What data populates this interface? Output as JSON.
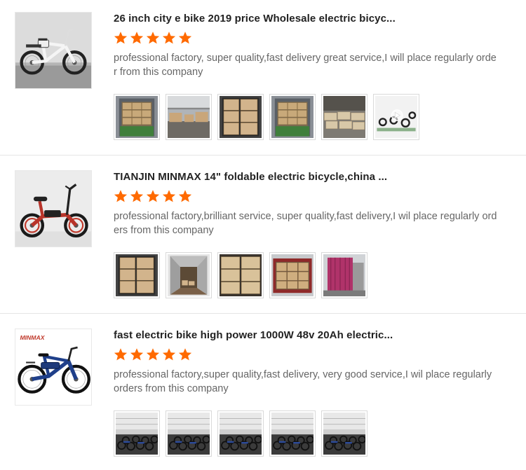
{
  "reviews": [
    {
      "title": "26 inch city e bike 2019 price Wholesale electric bicyc...",
      "rating": 5,
      "comment": "professional factory, super quality,fast delivery great service,I will place regularly order from this company",
      "product_image": "white-city-ebike",
      "photos": [
        {
          "name": "container-photo",
          "kind": "container"
        },
        {
          "name": "warehouse-photo",
          "kind": "warehouse"
        },
        {
          "name": "boxes-in-container-photo",
          "kind": "boxes-container"
        },
        {
          "name": "container-photo",
          "kind": "container"
        },
        {
          "name": "packed-boxes-photo",
          "kind": "boxes-floor"
        },
        {
          "name": "video-thumbnail",
          "kind": "video"
        }
      ]
    },
    {
      "title": "TIANJIN MINMAX 14\" foldable electric bicycle,china ...",
      "rating": 5,
      "comment": "professional factory,brilliant service, super quality,fast delivery,I wil place regularly orders from this company",
      "product_image": "red-foldable-ebike",
      "photos": [
        {
          "name": "boxes-in-container-photo",
          "kind": "boxes-container"
        },
        {
          "name": "empty-container-photo",
          "kind": "empty-container"
        },
        {
          "name": "stacked-boxes-photo",
          "kind": "boxes-stack"
        },
        {
          "name": "loaded-container-photo",
          "kind": "container-red"
        },
        {
          "name": "container-truck-photo",
          "kind": "container-pink"
        }
      ]
    },
    {
      "title": "fast electric bike high power 1000W 48v 20Ah electric...",
      "rating": 5,
      "comment": "professional factory,super quality,fast delivery, very good service,I wil place regularly orders from this company",
      "product_image": "blue-mtb-ebike",
      "brand_logo": "MINMAX",
      "photos": [
        {
          "name": "factory-bikes-photo",
          "kind": "factory"
        },
        {
          "name": "factory-bikes-photo",
          "kind": "factory"
        },
        {
          "name": "factory-bikes-photo",
          "kind": "factory"
        },
        {
          "name": "factory-bikes-photo",
          "kind": "factory"
        },
        {
          "name": "factory-bikes-photo",
          "kind": "factory"
        }
      ]
    }
  ],
  "colors": {
    "star": "#ff6a00",
    "title": "#222222",
    "comment": "#666666",
    "divider": "#e5e5e5",
    "photo_border": "#d9d9d9"
  }
}
